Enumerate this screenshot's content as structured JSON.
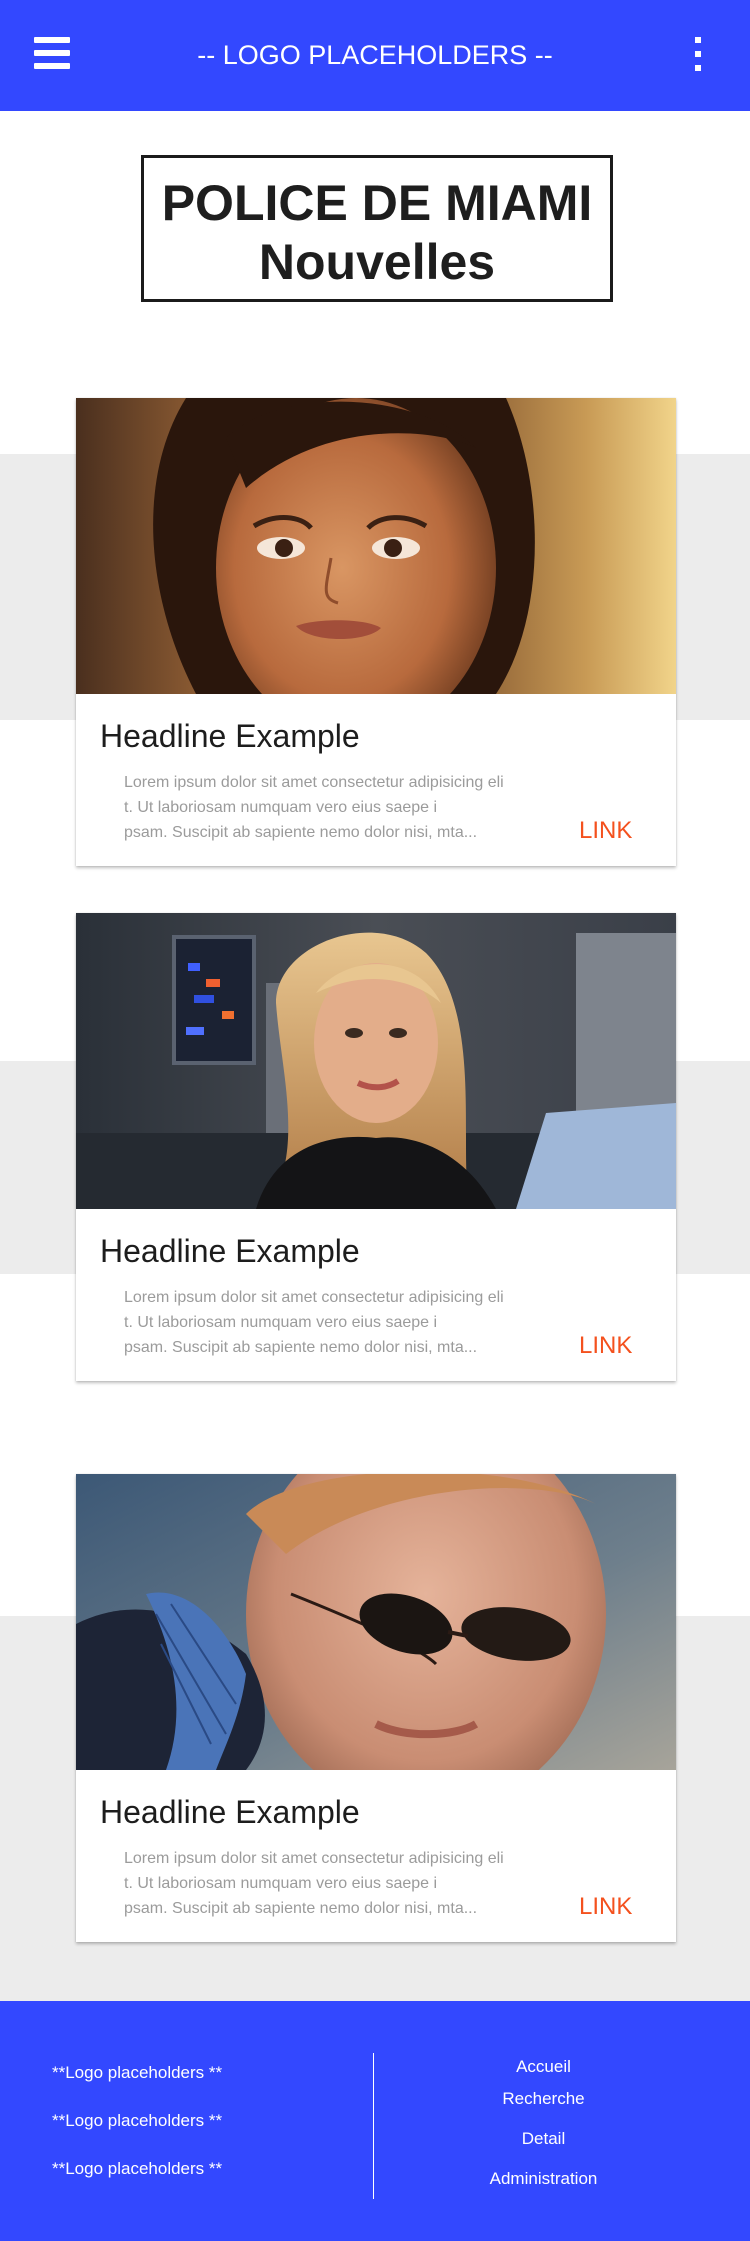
{
  "header": {
    "title": "-- LOGO PLACEHOLDERS --",
    "menu_icon": "hamburger-menu-icon",
    "more_icon": "more-vertical-icon",
    "color": "#3348ff"
  },
  "page_title": {
    "line1": "POLICE DE MIAMI",
    "line2": "Nouvelles"
  },
  "cards": [
    {
      "image": "woman-brunette-portrait",
      "headline": "Headline Example",
      "body": "Lorem ipsum dolor sit amet consectetur adipisicing eli\nt. Ut laboriosam numquam vero eius saepe i\npsam. Suscipit ab sapiente nemo dolor nisi, mta...",
      "link": "LINK"
    },
    {
      "image": "woman-blonde-in-lab",
      "headline": "Headline Example",
      "body": "Lorem ipsum dolor sit amet consectetur adipisicing eli\nt. Ut laboriosam numquam vero eius saepe i\npsam. Suscipit ab sapiente nemo dolor nisi, mta...",
      "link": "LINK"
    },
    {
      "image": "man-with-sunglasses",
      "headline": "Headline Example",
      "body": "Lorem ipsum dolor sit amet consectetur adipisicing eli\nt. Ut laboriosam numquam vero eius saepe i\npsam. Suscipit ab sapiente nemo dolor nisi, mta...",
      "link": "LINK"
    }
  ],
  "footer": {
    "logos": [
      "**Logo placeholders **",
      "**Logo placeholders **",
      "**Logo placeholders **"
    ],
    "links": [
      "Accueil",
      "Recherche",
      "Detail",
      "Administration"
    ]
  },
  "colors": {
    "accent": "#3348ff",
    "link": "#f4511e",
    "band": "#ececec"
  }
}
